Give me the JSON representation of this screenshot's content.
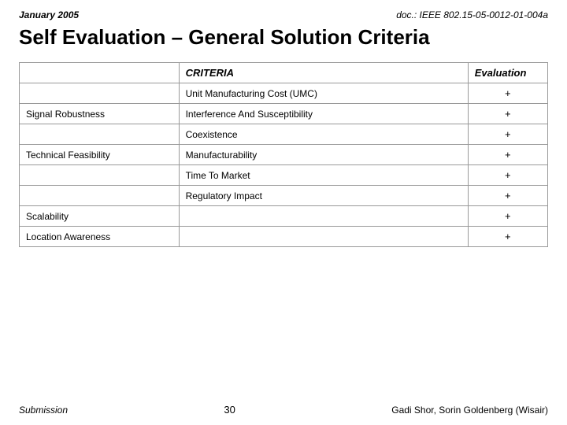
{
  "header": {
    "date": "January 2005",
    "doc": "doc.: IEEE 802.15-05-0012-01-004a"
  },
  "title": "Self Evaluation – General Solution Criteria",
  "table": {
    "col1_header": "",
    "col2_header": "CRITERIA",
    "col3_header": "Evaluation",
    "rows": [
      {
        "group": "",
        "criteria": "Unit Manufacturing Cost (UMC)",
        "eval": "+"
      },
      {
        "group": "Signal Robustness",
        "criteria": "Interference And Susceptibility",
        "eval": "+"
      },
      {
        "group": "",
        "criteria": "Coexistence",
        "eval": "+"
      },
      {
        "group": "Technical Feasibility",
        "criteria": "Manufacturability",
        "eval": "+"
      },
      {
        "group": "",
        "criteria": "Time To Market",
        "eval": "+"
      },
      {
        "group": "",
        "criteria": "Regulatory Impact",
        "eval": "+"
      },
      {
        "group": "Scalability",
        "criteria": "",
        "eval": "+"
      },
      {
        "group": "Location Awareness",
        "criteria": "",
        "eval": "+"
      }
    ]
  },
  "footer": {
    "left": "Submission",
    "center": "30",
    "right": "Gadi Shor, Sorin Goldenberg (Wisair)"
  }
}
